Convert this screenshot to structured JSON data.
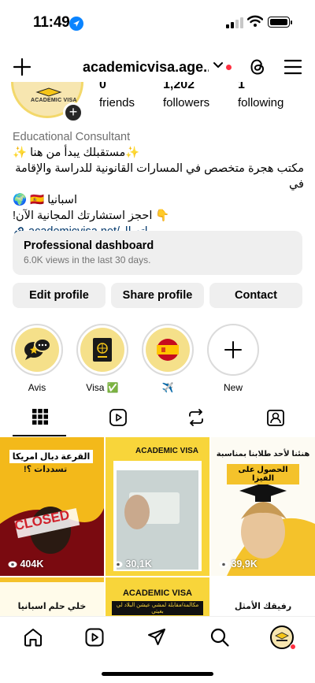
{
  "status_bar": {
    "time": "11:49"
  },
  "header": {
    "username": "academicvisa.age...",
    "plus_icon": "plus-icon",
    "threads_icon": "threads-icon",
    "menu_icon": "hamburger-menu-icon"
  },
  "profile": {
    "avatar_text": "ACADEMIC VISA",
    "stats": [
      {
        "value": "0",
        "label": "friends"
      },
      {
        "value": "1,202",
        "label": "followers"
      },
      {
        "value": "1",
        "label": "following"
      }
    ],
    "category": "Educational Consultant",
    "bio_lines": [
      "✨مستقبلك يبدأ من هنا ✨",
      "مكتب هجرة متخصص في المسارات القانونية للدراسة والإقامة في",
      "اسبانيا 🇪🇸 🌍",
      "👇 احجز استشارتك المجانية الآن!"
    ],
    "link": "academicvisa.net/اتصال"
  },
  "dashboard": {
    "title": "Professional dashboard",
    "subtitle": "6.0K views in the last 30 days."
  },
  "buttons": {
    "edit": "Edit profile",
    "share": "Share profile",
    "contact": "Contact"
  },
  "highlights": [
    {
      "label": "Avis"
    },
    {
      "label": "Visa ✅"
    },
    {
      "label": "✈️"
    },
    {
      "label": "New"
    }
  ],
  "tabs": [
    "grid-icon",
    "reels-icon",
    "reposts-icon",
    "tagged-icon"
  ],
  "posts": [
    {
      "views": "404K",
      "headline": "القرعة ديال امريكا",
      "sub": "تسددات ؟!",
      "stamp": "CLOSED"
    },
    {
      "views": "30,1K",
      "headline": "ACADEMIC VISA"
    },
    {
      "views": "39,9K",
      "headline": "هنئنا لأحد طلابنا بمناسبة",
      "sub": "الحصول على الفيزا"
    },
    {
      "headline": "خلي حلم اسبانيا"
    },
    {
      "headline": "ACADEMIC VISA",
      "sub": "مكالمة/مقابلة لمشي عيشن البلاد لي بغيتي"
    },
    {
      "headline": "رفيقك الأمثل"
    }
  ],
  "colors": {
    "accent_yellow": "#f5c518",
    "link_blue": "#00376b",
    "badge_red": "#ff3040"
  },
  "bottom_nav": [
    "home-icon",
    "reels-icon",
    "send-icon",
    "search-icon",
    "profile-avatar"
  ]
}
